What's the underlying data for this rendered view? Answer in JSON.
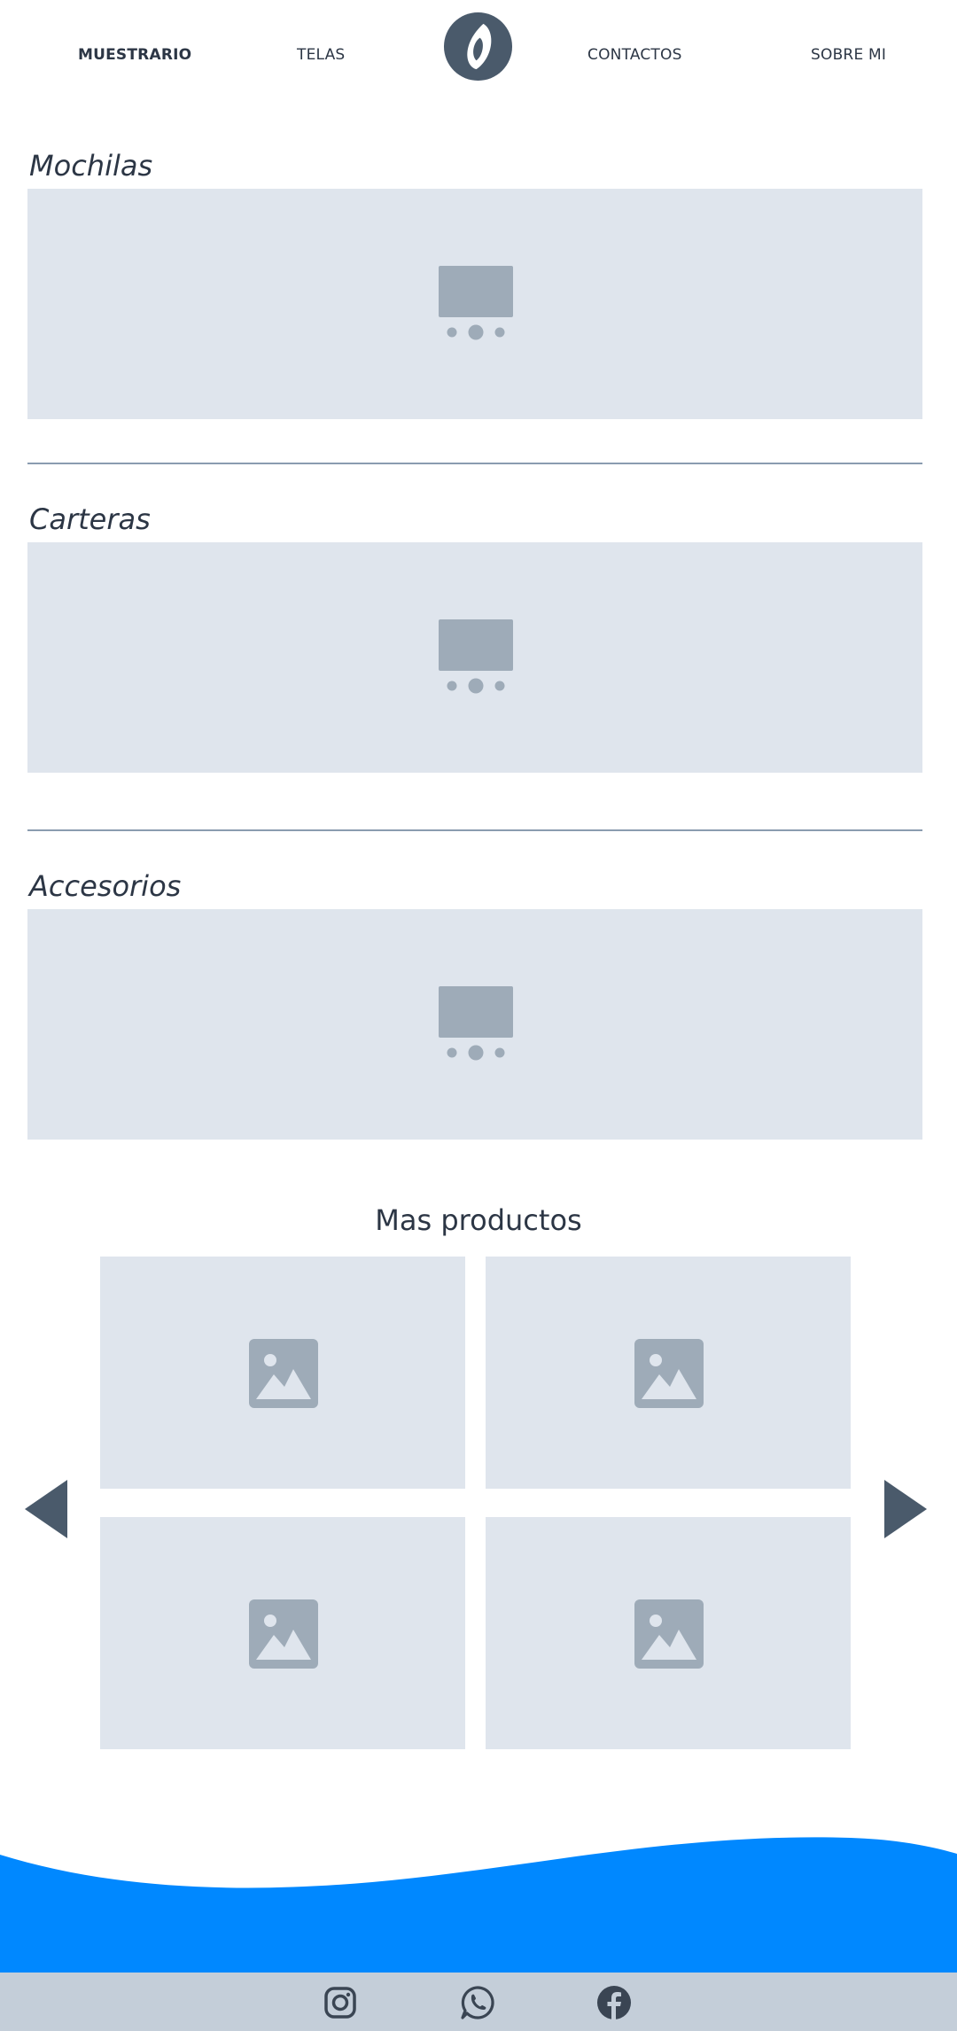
{
  "nav": {
    "items": [
      {
        "label": "MUESTRARIO"
      },
      {
        "label": "TELAS"
      },
      {
        "label": "CONTACTOS"
      },
      {
        "label": "SOBRE MI"
      }
    ],
    "logo_icon": "brand-logo-icon"
  },
  "sections": [
    {
      "title": "Mochilas",
      "media_icon": "slideshow-placeholder-icon"
    },
    {
      "title": "Carteras",
      "media_icon": "slideshow-placeholder-icon"
    },
    {
      "title": "Accesorios",
      "media_icon": "slideshow-placeholder-icon"
    }
  ],
  "more_products": {
    "title": "Mas productos",
    "tile_icon": "image-placeholder-icon",
    "prev_icon": "triangle-left-icon",
    "next_icon": "triangle-right-icon"
  },
  "footer": {
    "icons": [
      "instagram-icon",
      "whatsapp-icon",
      "facebook-icon"
    ]
  },
  "colors": {
    "text": "#2c3645",
    "placeholder_bg": "#dfe5ed",
    "placeholder_icon": "#9eabb8",
    "divider": "#8a9cb0",
    "arrow": "#4a5a6b",
    "wave": "#0088ff",
    "footer_bg": "#c4ced9"
  }
}
